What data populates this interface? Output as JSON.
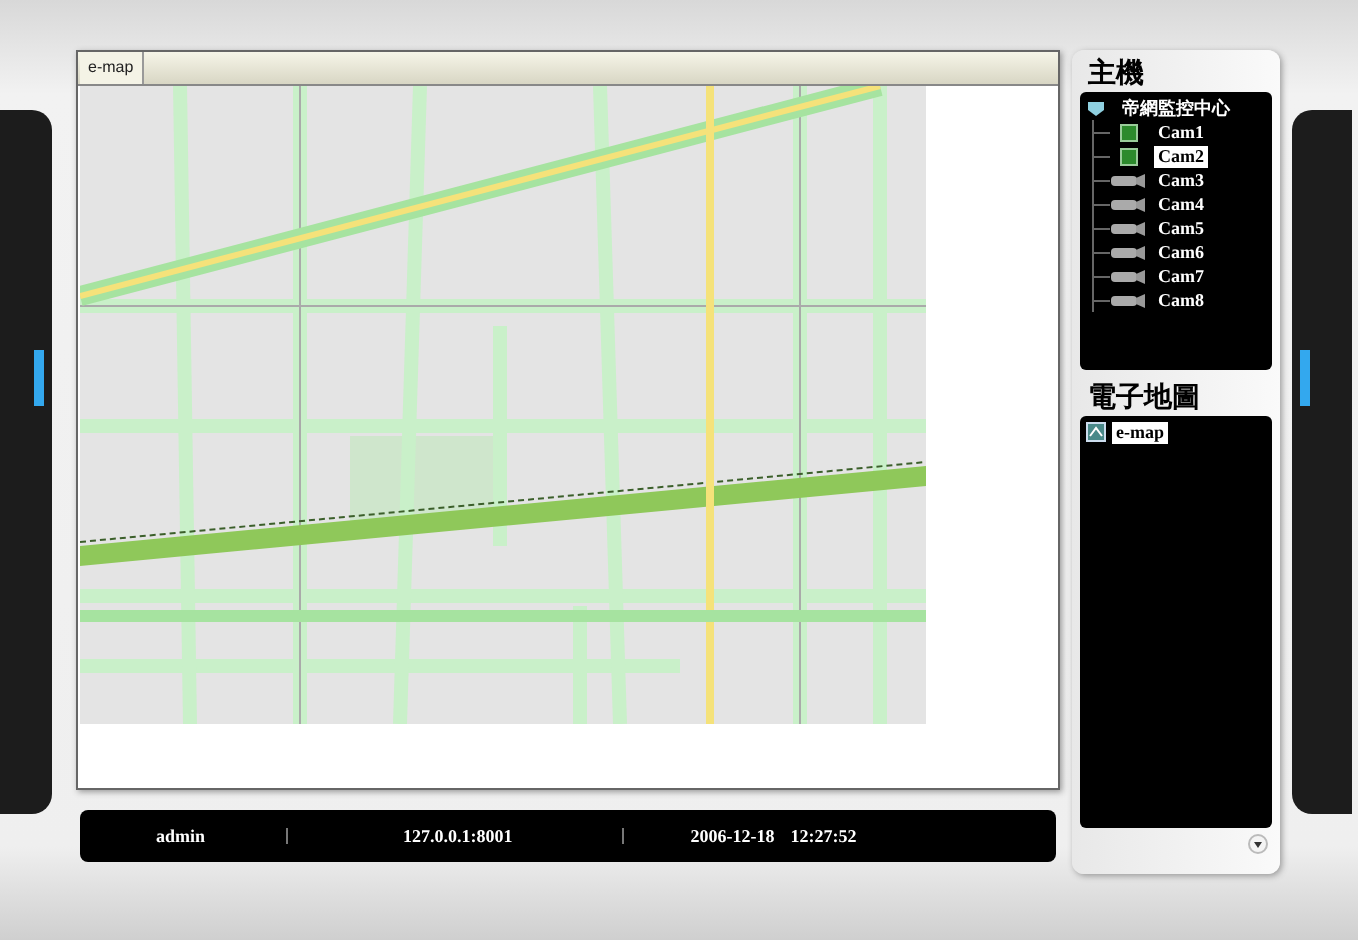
{
  "map_view": {
    "tabs": [
      {
        "label": "e-map",
        "selected": true
      }
    ]
  },
  "status_bar": {
    "user": "admin",
    "address": "127.0.0.1:8001",
    "date": "2006-12-18",
    "time": "12:27:52"
  },
  "host_panel": {
    "title": "主機",
    "tree": [
      {
        "label": "帝網監控中心",
        "expanded": true,
        "selected": false,
        "children": [
          {
            "label": "Cam1",
            "online": true,
            "selected": false
          },
          {
            "label": "Cam2",
            "online": true,
            "selected": true
          },
          {
            "label": "Cam3",
            "online": false,
            "selected": false
          },
          {
            "label": "Cam4",
            "online": false,
            "selected": false
          },
          {
            "label": "Cam5",
            "online": false,
            "selected": false
          },
          {
            "label": "Cam6",
            "online": false,
            "selected": false
          },
          {
            "label": "Cam7",
            "online": false,
            "selected": false
          },
          {
            "label": "Cam8",
            "online": false,
            "selected": false
          }
        ]
      }
    ]
  },
  "emap_panel": {
    "title": "電子地圖",
    "items": [
      {
        "label": "e-map",
        "selected": true
      }
    ]
  }
}
